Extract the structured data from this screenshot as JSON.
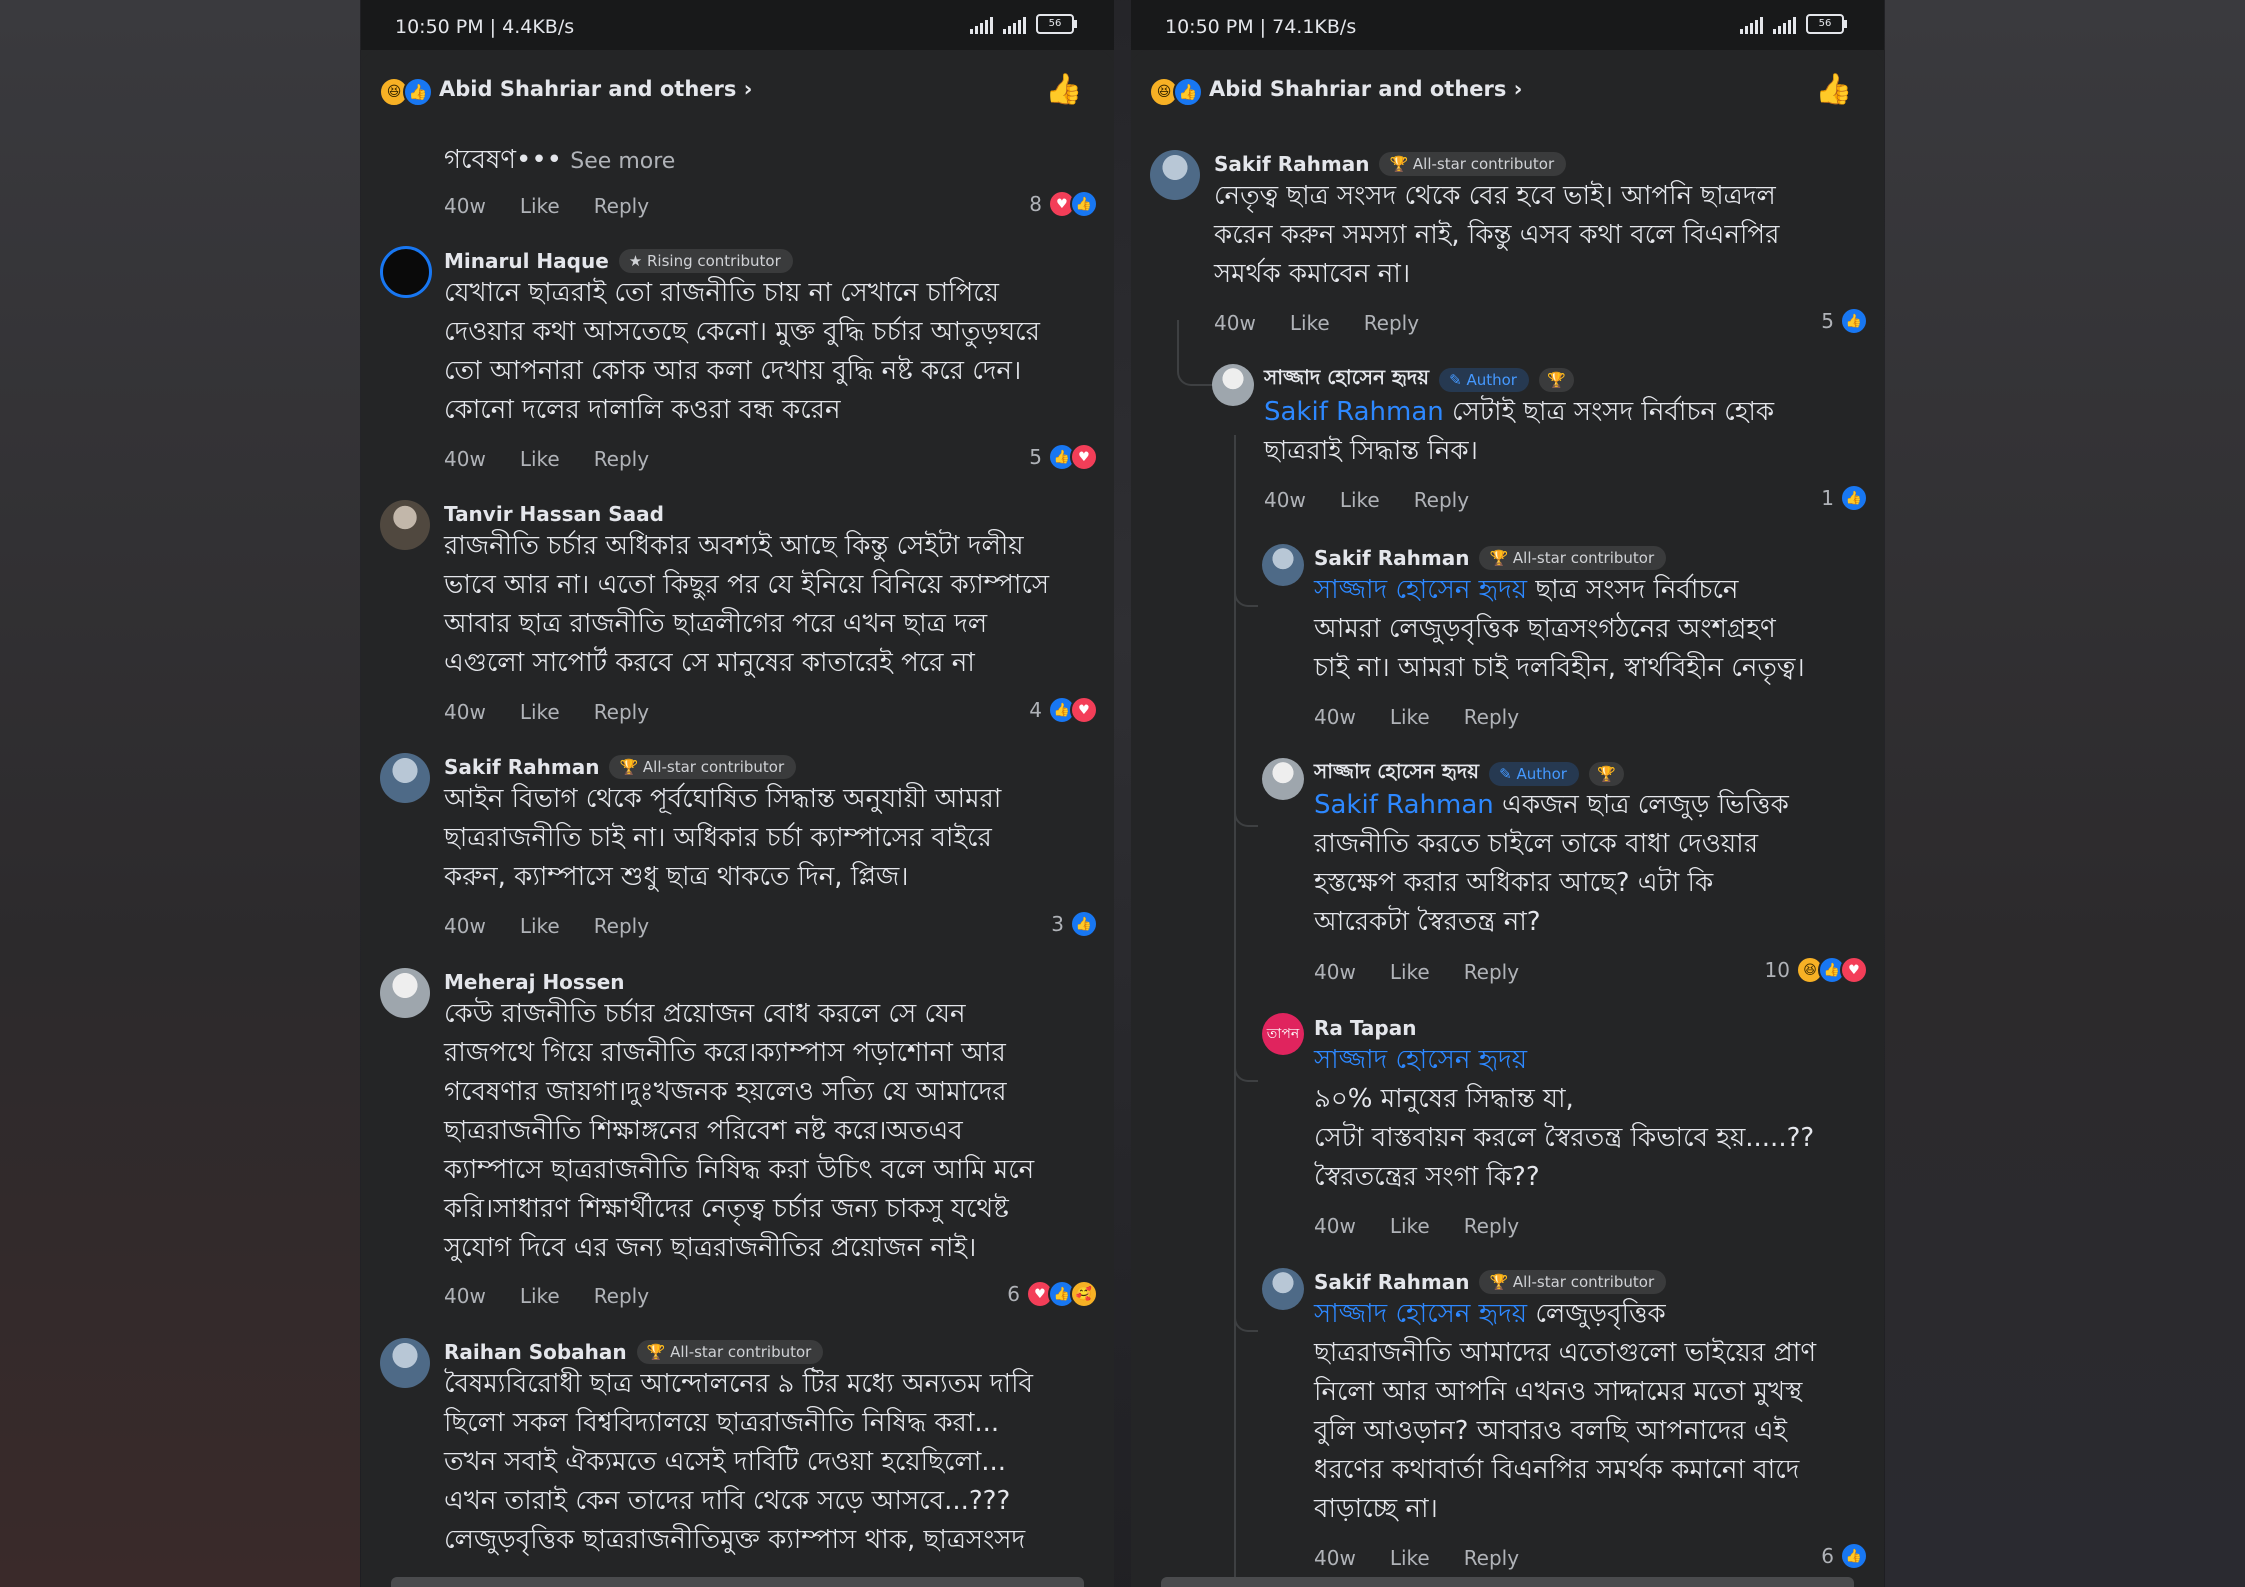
{
  "left": {
    "status": {
      "time": "10:50 PM | 4.4KB/s",
      "battery": "56"
    },
    "header": {
      "reactors": "Abid Shahriar and others"
    },
    "top_fragment": {
      "text": "গবেষণ•••",
      "see_more": "See more",
      "time": "40w",
      "like": "Like",
      "reply": "Reply",
      "count": "8"
    },
    "comments": [
      {
        "name": "Minarul Haque",
        "badge": "Rising contributor",
        "lines": [
          "যেখানে ছাত্ররাই তো রাজনীতি চায় না সেখানে চাপিয়ে",
          "দেওয়ার কথা আসতেছে কেনো। মুক্ত বুদ্ধি চর্চার আতুড়ঘরে",
          "তো আপনারা কোক আর কলা দেখায় বুদ্ধি নষ্ট করে দেন।",
          "কোনো দলের দালালি কওরা বন্ধ করেন"
        ],
        "time": "40w",
        "like": "Like",
        "reply": "Reply",
        "count": "5"
      },
      {
        "name": "Tanvir Hassan Saad",
        "lines": [
          "রাজনীতি চর্চার অধিকার অবশ্যই আছে কিন্তু সেইটা দলীয়",
          "ভাবে আর না। এতো কিছুর পর যে ইনিয়ে বিনিয়ে ক্যাম্পাসে",
          "আবার ছাত্র রাজনীতি ছাত্রলীগের পরে এখন ছাত্র দল",
          "এগুলো সাপোর্ট করবে সে মানুষের কাতারেই পরে না"
        ],
        "time": "40w",
        "like": "Like",
        "reply": "Reply",
        "count": "4"
      },
      {
        "name": "Sakif Rahman",
        "badge": "All-star contributor",
        "lines": [
          "আইন বিভাগ থেকে পূর্বঘোষিত সিদ্ধান্ত অনুযায়ী আমরা",
          "ছাত্ররাজনীতি চাই না। অধিকার চর্চা ক্যাম্পাসের বাইরে",
          "করুন, ক্যাম্পাসে শুধু ছাত্র থাকতে দিন, প্লিজ।"
        ],
        "time": "40w",
        "like": "Like",
        "reply": "Reply",
        "count": "3"
      },
      {
        "name": "Meheraj Hossen",
        "lines": [
          "কেউ রাজনীতি চর্চার প্রয়োজন বোধ করলে সে যেন",
          "রাজপথে গিয়ে রাজনীতি করে।ক্যাম্পাস পড়াশোনা আর",
          "গবেষণার জায়গা।দুঃখজনক হয়লেও সত্যি যে আমাদের",
          "ছাত্ররাজনীতি শিক্ষাঙ্গনের পরিবেশ নষ্ট করে।অতএব",
          "ক্যাম্পাসে ছাত্ররাজনীতি নিষিদ্ধ করা উচিৎ বলে আমি মনে",
          "করি।সাধারণ শিক্ষার্থীদের নেতৃত্ব চর্চার জন্য  চাকসু যথেষ্ট",
          "সুযোগ দিবে এর জন্য ছাত্ররাজনীতির প্রয়োজন নাই।"
        ],
        "time": "40w",
        "like": "Like",
        "reply": "Reply",
        "count": "6"
      },
      {
        "name": "Raihan Sobahan",
        "badge": "All-star contributor",
        "lines": [
          "বৈষম্যবিরোধী ছাত্র আন্দোলনের ৯ টির মধ্যে অন্যতম দাবি",
          "ছিলো সকল বিশ্ববিদ্যালয়ে ছাত্ররাজনীতি নিষিদ্ধ করা...",
          "তখন সবাই ঐক্যমতে এসেই দাবিটি দেওয়া হয়েছিলো...",
          "এখন তারাই কেন তাদের দাবি থেকে সড়ে আসবে...???",
          "লেজুড়বৃত্তিক ছাত্ররাজনীতিমুক্ত ক্যাম্পাস থাক, ছাত্রসংসদ"
        ]
      }
    ]
  },
  "right": {
    "status": {
      "time": "10:50 PM | 74.1KB/s",
      "battery": "56"
    },
    "header": {
      "reactors": "Abid Shahriar and others"
    },
    "comments": [
      {
        "name": "Sakif Rahman",
        "badge": "All-star contributor",
        "lines": [
          "নেতৃত্ব ছাত্র সংসদ থেকে বের হবে ভাই। আপনি ছাত্রদল",
          "করেন করুন সমস্যা নাই, কিন্তু এসব কথা বলে বিএনপির",
          "সমর্থক কমাবেন না।"
        ],
        "time": "40w",
        "like": "Like",
        "reply": "Reply",
        "count": "5"
      },
      {
        "name": "সাজ্জাদ হোসেন হৃদয়",
        "badge": "Author",
        "mention": "Sakif Rahman",
        "lines": [
          "সেটাই ছাত্র সংসদ নির্বাচন হোক",
          "ছাত্ররাই সিদ্ধান্ত নিক।"
        ],
        "time": "40w",
        "like": "Like",
        "reply": "Reply",
        "count": "1"
      },
      {
        "name": "Sakif Rahman",
        "badge": "All-star contributor",
        "mention": "সাজ্জাদ হোসেন হৃদয়",
        "lines": [
          "ছাত্র সংসদ নির্বাচনে",
          "আমরা লেজুড়বৃত্তিক ছাত্রসংগঠনের অংশগ্রহণ",
          "চাই না। আমরা চাই দলবিহীন, স্বার্থবিহীন নেতৃত্ব।"
        ],
        "time": "40w",
        "like": "Like",
        "reply": "Reply"
      },
      {
        "name": "সাজ্জাদ হোসেন হৃদয়",
        "badge": "Author",
        "mention": "Sakif Rahman",
        "lines": [
          "একজন ছাত্র লেজুড় ভিত্তিক",
          "রাজনীতি করতে চাইলে তাকে বাধা দেওয়ার",
          "হস্তক্ষেপ করার অধিকার আছে? এটা কি",
          "আরেকটা স্বৈরতন্ত্র না?"
        ],
        "time": "40w",
        "like": "Like",
        "reply": "Reply",
        "count": "10"
      },
      {
        "name": "Ra Tapan",
        "avatar_text": "তাপন",
        "mention": "সাজ্জাদ হোসেন হৃদয়",
        "lines": [
          "৯০% মানুষের সিদ্ধান্ত যা,",
          "সেটা বাস্তবায়ন করলে স্বৈরতন্ত্র কিভাবে হয়.....??",
          "স্বৈরতন্ত্রের সংগা কি??"
        ],
        "time": "40w",
        "like": "Like",
        "reply": "Reply"
      },
      {
        "name": "Sakif Rahman",
        "badge": "All-star contributor",
        "mention": "সাজ্জাদ হোসেন হৃদয়",
        "lines": [
          "লেজুড়বৃত্তিক",
          "ছাত্ররাজনীতি আমাদের এতোগুলো ভাইয়ের প্রাণ",
          "নিলো আর আপনি এখনও সাদ্দামের মতো মুখস্থ",
          "বুলি আওড়ান? আবারও বলছি আপনাদের এই",
          "ধরণের কথাবার্তা বিএনপির সমর্থক কমানো বাদে",
          "বাড়াচ্ছে না।"
        ],
        "time": "40w",
        "like": "Like",
        "reply": "Reply",
        "count": "6"
      }
    ]
  },
  "icons": {
    "like": "👍",
    "love": "♥",
    "haha": "😆",
    "care": "🥰",
    "chevron": "›",
    "trophy": "🏆",
    "star": "★",
    "pencil": "✎"
  },
  "colors": {
    "background": "#242526",
    "text": "#e4e6eb",
    "secondary": "#b0b3b8",
    "mention": "#2d88ff",
    "like": "#1877f2",
    "love": "#f33e58",
    "badge_bg": "#3a3b3c"
  }
}
